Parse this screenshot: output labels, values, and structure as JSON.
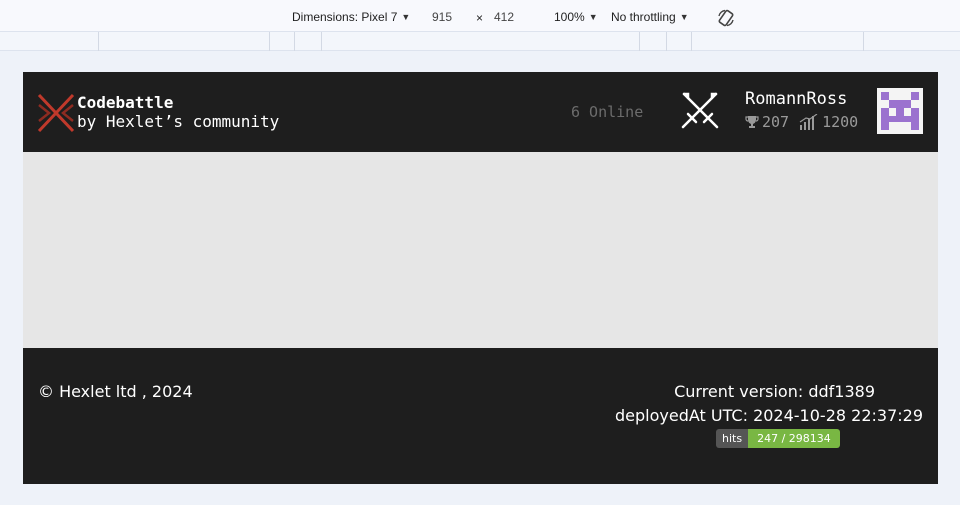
{
  "devtools": {
    "dimensions_label": "Dimensions: Pixel 7",
    "width_value": "915",
    "times_symbol": "×",
    "height_value": "412",
    "zoom": "100%",
    "throttling": "No throttling",
    "icons": [
      "chevron-down-icon",
      "rotate-icon"
    ]
  },
  "header": {
    "logo_title": "Codebattle",
    "logo_subtitle": "by Hexlet’s community",
    "online": "6 Online",
    "username": "RomannRoss",
    "trophies": "207",
    "rating": "1200",
    "icons": [
      "codebattle-logo-icon",
      "crossed-swords-icon",
      "trophy-icon",
      "rating-chart-icon",
      "avatar-invader-icon"
    ],
    "colors": {
      "background": "#1e1e1e",
      "logo_accent": "#c0392b",
      "avatar": "#9b72cf"
    }
  },
  "footer": {
    "copyright": "© Hexlet ltd , 2024",
    "version": "Current version: ddf1389",
    "deployed": "deployedAt UTC: 2024-10-28 22:37:29",
    "hits_label": "hits",
    "hits_value": "247 / 298134",
    "colors": {
      "hits_label_bg": "#555555",
      "hits_value_bg": "#79b743"
    }
  }
}
